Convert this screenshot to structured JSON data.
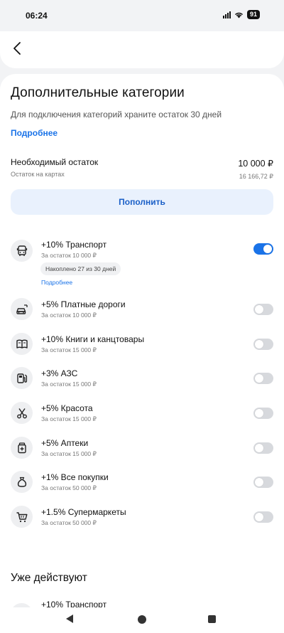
{
  "status": {
    "time": "06:24",
    "battery": "91"
  },
  "header": {
    "title": "Дополнительные категории",
    "subtitle": "Для подключения категорий храните остаток 30 дней",
    "more_link": "Подробнее"
  },
  "balance": {
    "label": "Необходимый остаток",
    "value": "10 000 ₽",
    "sub_label": "Остаток на картах",
    "sub_value": "16 166,72 ₽"
  },
  "topup_button": "Пополнить",
  "categories": [
    {
      "title": "+10% Транспорт",
      "sub": "За остаток 10 000 ₽",
      "chip": "Накоплено 27 из 30 дней",
      "link": "Подробнее",
      "enabled": true,
      "icon": "bus-icon"
    },
    {
      "title": "+5% Платные дороги",
      "sub": "За остаток 10 000 ₽",
      "enabled": false,
      "icon": "car-toll-icon"
    },
    {
      "title": "+10% Книги и канцтовары",
      "sub": "За остаток 15 000 ₽",
      "enabled": false,
      "icon": "book-icon"
    },
    {
      "title": "+3% АЗС",
      "sub": "За остаток 15 000 ₽",
      "enabled": false,
      "icon": "fuel-icon"
    },
    {
      "title": "+5% Красота",
      "sub": "За остаток 15 000 ₽",
      "enabled": false,
      "icon": "scissors-icon"
    },
    {
      "title": "+5% Аптеки",
      "sub": "За остаток 15 000 ₽",
      "enabled": false,
      "icon": "medicine-icon"
    },
    {
      "title": "+1% Все покупки",
      "sub": "За остаток 50 000 ₽",
      "enabled": false,
      "icon": "bag-icon"
    },
    {
      "title": "+1.5% Супермаркеты",
      "sub": "За остаток 50 000 ₽",
      "enabled": false,
      "icon": "cart-icon"
    }
  ],
  "active_section": {
    "title": "Уже действуют",
    "first_item": "+10% Транспорт"
  },
  "colors": {
    "accent": "#1a73e8",
    "toggle_off": "#d7d9dd",
    "button_bg": "#e9f1fd"
  }
}
